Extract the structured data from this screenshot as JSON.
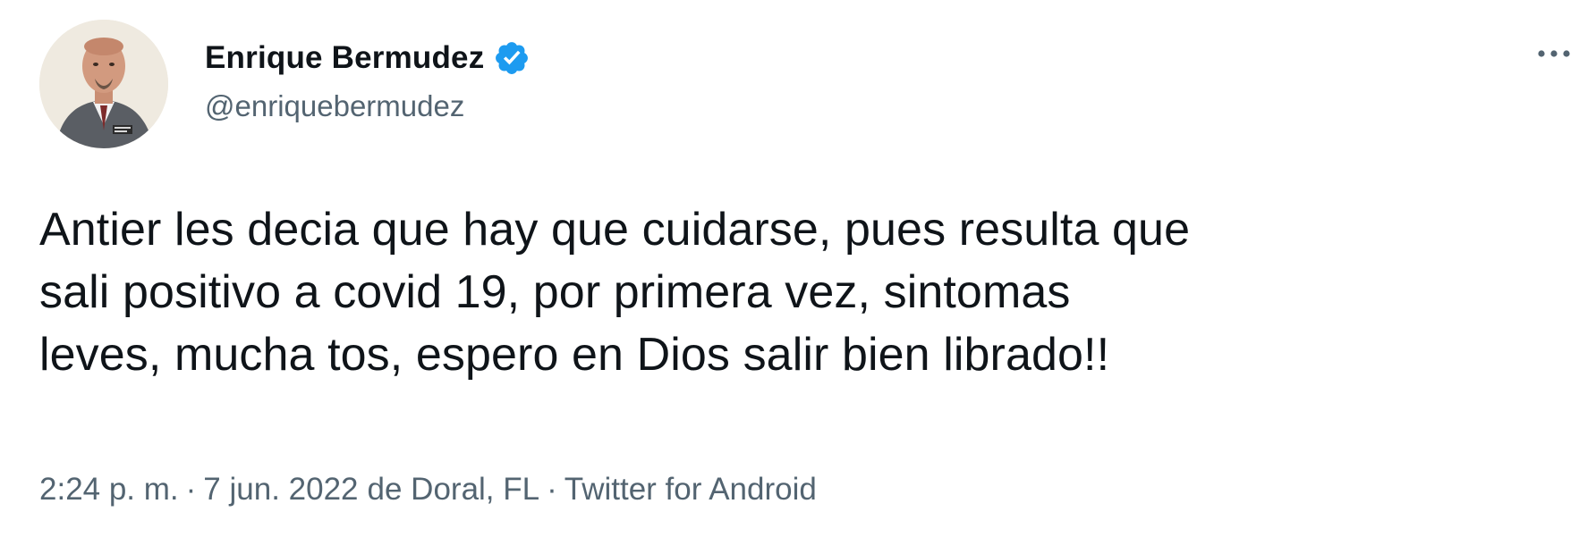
{
  "user": {
    "display_name": "Enrique Bermudez",
    "handle": "@enriquebermudez",
    "verified": true,
    "avatar_icon": "profile-photo"
  },
  "tweet": {
    "text_lines": [
      "Antier les decia que hay que cuidarse, pues resulta que",
      "sali positivo a covid 19, por primera vez, sintomas",
      "leves, mucha tos, espero en Dios salir bien librado!!"
    ]
  },
  "meta": {
    "time": "2:24 p. m.",
    "separator": "·",
    "date": "7 jun. 2022",
    "location": "de Doral, FL",
    "source": "Twitter for Android"
  },
  "colors": {
    "verified_badge": "#1d9bf0",
    "secondary_text": "#536471",
    "primary_text": "#0f1419"
  },
  "icons": {
    "more": "more-horizontal-icon",
    "verified": "verified-badge-icon"
  }
}
